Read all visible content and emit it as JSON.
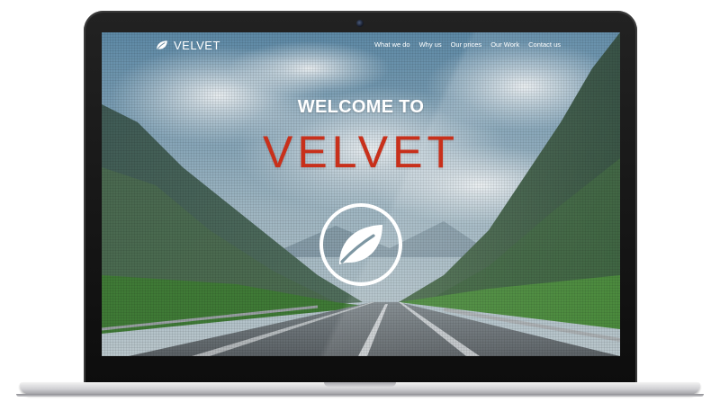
{
  "brand": {
    "name": "VELVET",
    "icon": "leaf-icon"
  },
  "nav": {
    "items": [
      {
        "label": "What we do"
      },
      {
        "label": "Why us"
      },
      {
        "label": "Our prices"
      },
      {
        "label": "Our Work"
      },
      {
        "label": "Contact us"
      }
    ]
  },
  "hero": {
    "welcome": "WELCOME TO",
    "title": "VELVET",
    "emblem_icon": "leaf-icon"
  },
  "colors": {
    "accent": "#c8301b",
    "text_on_image": "#ffffff"
  }
}
